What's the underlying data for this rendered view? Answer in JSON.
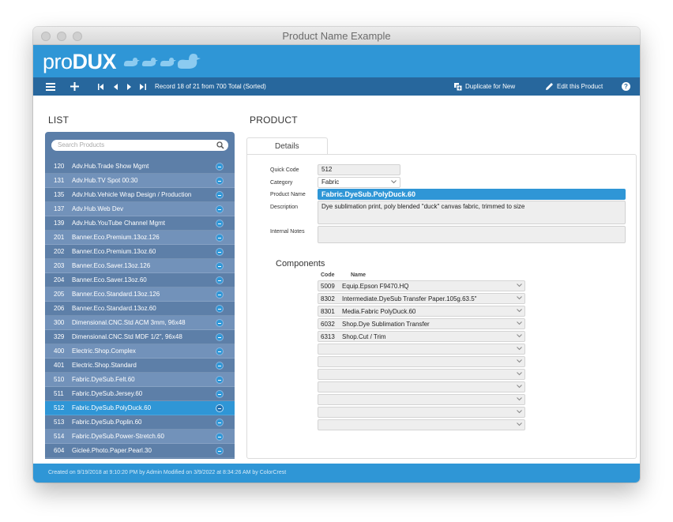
{
  "window": {
    "title": "Product Name Example"
  },
  "brand": {
    "pro": "pro",
    "dux": "DUX"
  },
  "toolbar": {
    "record_info": "Record 18 of 21 from 700 Total (Sorted)",
    "duplicate_label": "Duplicate for New",
    "edit_label": "Edit this Product",
    "help_label": "?"
  },
  "list": {
    "title": "LIST",
    "search_placeholder": "Search Products",
    "items": [
      {
        "code": "120",
        "name": "Adv.Hub.Trade Show Mgmt"
      },
      {
        "code": "131",
        "name": "Adv.Hub.TV Spot 00:30"
      },
      {
        "code": "135",
        "name": "Adv.Hub.Vehicle Wrap Design / Production"
      },
      {
        "code": "137",
        "name": "Adv.Hub.Web Dev"
      },
      {
        "code": "139",
        "name": "Adv.Hub.YouTube Channel Mgmt"
      },
      {
        "code": "201",
        "name": "Banner.Eco.Premium.13oz.126"
      },
      {
        "code": "202",
        "name": "Banner.Eco.Premium.13oz.60"
      },
      {
        "code": "203",
        "name": "Banner.Eco.Saver.13oz.126"
      },
      {
        "code": "204",
        "name": "Banner.Eco.Saver.13oz.60"
      },
      {
        "code": "205",
        "name": "Banner.Eco.Standard.13oz.126"
      },
      {
        "code": "206",
        "name": "Banner.Eco.Standard.13oz.60"
      },
      {
        "code": "300",
        "name": "Dimensional.CNC.Std ACM 3mm, 96x48"
      },
      {
        "code": "329",
        "name": "Dimensional.CNC.Std MDF 1/2\", 96x48"
      },
      {
        "code": "400",
        "name": "Electric.Shop.Complex"
      },
      {
        "code": "401",
        "name": "Electric.Shop.Standard"
      },
      {
        "code": "510",
        "name": "Fabric.DyeSub.Felt.60"
      },
      {
        "code": "511",
        "name": "Fabric.DyeSub.Jersey.60"
      },
      {
        "code": "512",
        "name": "Fabric.DyeSub.PolyDuck.60"
      },
      {
        "code": "513",
        "name": "Fabric.DyeSub.Poplin.60"
      },
      {
        "code": "514",
        "name": "Fabric.DyeSub.Power-Stretch.60"
      },
      {
        "code": "604",
        "name": "Gicleé.Photo.Paper.Pearl.30"
      }
    ]
  },
  "product": {
    "title": "PRODUCT",
    "tab_label": "Details",
    "quick_code_label": "Quick Code",
    "quick_code": "512",
    "category_label": "Category",
    "category": "Fabric",
    "product_name_label": "Product Name",
    "product_name": "Fabric.DyeSub.PolyDuck.60",
    "description_label": "Description",
    "description": "Dye sublimation print, poly blended \"duck\" canvas fabric, trimmed to size",
    "internal_notes_label": "Internal Notes",
    "internal_notes": ""
  },
  "components": {
    "title": "Components",
    "code_header": "Code",
    "name_header": "Name",
    "rows": [
      {
        "code": "5009",
        "name": "Equip.Epson F9470.HQ"
      },
      {
        "code": "8302",
        "name": "Intermediate.DyeSub Transfer Paper.105g.63.5\""
      },
      {
        "code": "8301",
        "name": "Media.Fabric PolyDuck.60"
      },
      {
        "code": "6032",
        "name": "Shop.Dye Sublimation Transfer"
      },
      {
        "code": "6313",
        "name": "Shop.Cut / Trim"
      },
      {
        "code": "",
        "name": ""
      },
      {
        "code": "",
        "name": ""
      },
      {
        "code": "",
        "name": ""
      },
      {
        "code": "",
        "name": ""
      },
      {
        "code": "",
        "name": ""
      },
      {
        "code": "",
        "name": ""
      },
      {
        "code": "",
        "name": ""
      }
    ]
  },
  "footer": {
    "text": "Created on 9/19/2018 at 9:10:20 PM by Admin   Modified on 3/9/2022 at 8:34:26 AM by ColorCrest"
  },
  "colors": {
    "brand_blue": "#2f96d6",
    "toolbar_blue": "#27679d",
    "list_bg": "#5b7ea8",
    "selected_row": "#2f96d6"
  }
}
